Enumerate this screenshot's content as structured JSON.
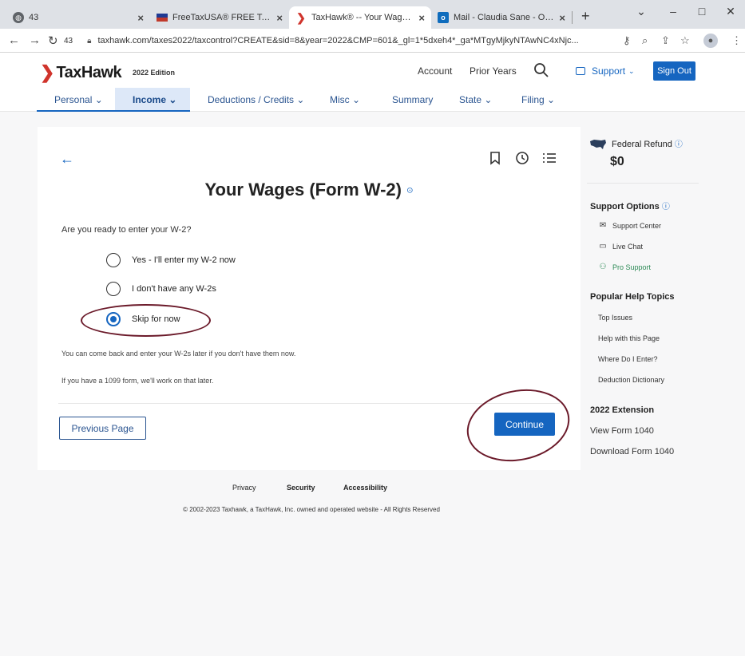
{
  "browser": {
    "tabs": [
      {
        "title": "43",
        "icon": "globe-icon"
      },
      {
        "title": "FreeTaxUSA® FREE Tax Filing",
        "icon": "flag-icon"
      },
      {
        "title": "TaxHawk® -- Your Wages (Fo",
        "icon": "hawk-icon"
      },
      {
        "title": "Mail - Claudia Sane - Outlook",
        "icon": "mail-icon"
      }
    ],
    "tab_close": "×",
    "new_tab": "+",
    "tab_count": "43",
    "url": "taxhawk.com/taxes2022/taxcontrol?CREATE&sid=8&year=2022&CMP=601&_gl=1*5dxeh4*_ga*MTgyMjkyNTAwNC4xNjc..."
  },
  "header": {
    "logo": "TaxHawk",
    "edition": "2022 Edition",
    "account": "Account",
    "prior_years": "Prior Years",
    "support": "Support",
    "sign_out": "Sign Out"
  },
  "nav": [
    {
      "label": "Personal"
    },
    {
      "label": "Income"
    },
    {
      "label": "Deductions / Credits"
    },
    {
      "label": "Misc"
    },
    {
      "label": "Summary"
    },
    {
      "label": "State"
    },
    {
      "label": "Filing"
    }
  ],
  "main": {
    "title": "Your Wages (Form W-2)",
    "question": "Are you ready to enter your W-2?",
    "options": [
      {
        "label": "Yes - I'll enter my W-2 now",
        "checked": false
      },
      {
        "label": "I don't have any W-2s",
        "checked": false
      },
      {
        "label": "Skip for now",
        "checked": true
      }
    ],
    "note1": "You can come back and enter your W-2s later if you don't have them now.",
    "note2": "If you have a 1099 form, we'll work on that later.",
    "previous": "Previous Page",
    "continue": "Continue"
  },
  "sidebar": {
    "refund_label": "Federal Refund",
    "refund_amount": "$0",
    "support_heading": "Support Options",
    "support_links": [
      "Support Center",
      "Live Chat",
      "Pro Support"
    ],
    "help_heading": "Popular Help Topics",
    "help_links": [
      "Top Issues",
      "Help with this Page",
      "Where Do I Enter?",
      "Deduction Dictionary"
    ],
    "ext_heading": "2022 Extension",
    "ext_links": [
      "View Form 1040",
      "Download Form 1040"
    ]
  },
  "footer": {
    "privacy": "Privacy",
    "security": "Security",
    "accessibility": "Accessibility",
    "copyright": "© 2002-2023 Taxhawk, a TaxHawk, Inc. owned and operated website - All Rights Reserved"
  },
  "colors": {
    "accent": "#1565c0",
    "logo_red": "#d0342c",
    "annotation": "#6b1a2a"
  }
}
